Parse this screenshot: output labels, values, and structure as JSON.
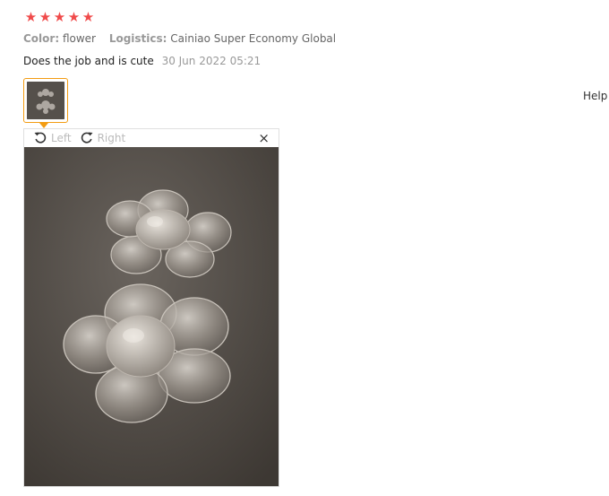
{
  "review": {
    "rating": 5,
    "stars": [
      "★",
      "★",
      "★",
      "★",
      "★"
    ],
    "color_key": "Color:",
    "color_value": "flower",
    "logistics_key": "Logistics:",
    "logistics_value": "Cainiao Super Economy Global",
    "text": "Does the job and is cute",
    "date": "30 Jun 2022 05:21"
  },
  "viewer": {
    "left_label": "Left",
    "right_label": "Right",
    "close_label": "×"
  },
  "help_label": "Help",
  "colors": {
    "star": "#f04a4a",
    "thumb_border": "#f39c12",
    "photo_bg": "#5b5650"
  },
  "icons": {
    "rotate_left": "rotate-left-icon",
    "rotate_right": "rotate-right-icon",
    "close": "close-icon"
  }
}
